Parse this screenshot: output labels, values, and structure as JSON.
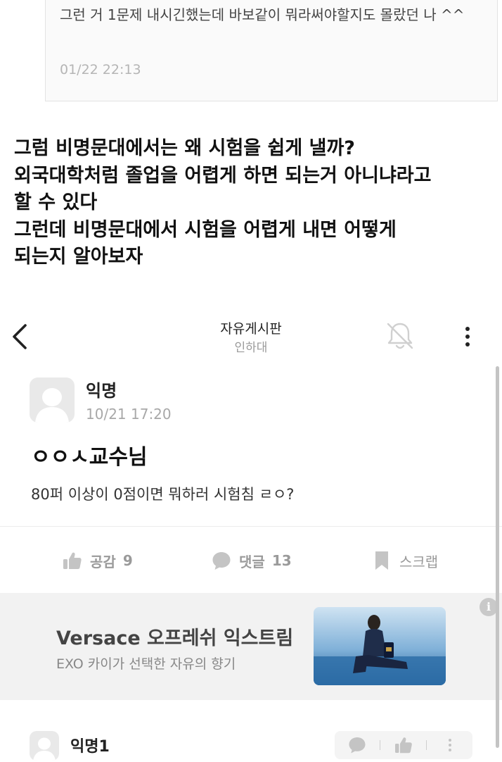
{
  "quote": {
    "text": "그런 거 1문제 내시긴했는데 바보같이 뭐라써야할지도 몰랐던 나 ^^",
    "time": "01/22 22:13"
  },
  "caption": {
    "text": "그럼 비명문대에서는 왜 시험을 쉽게 낼까?\n외국대학처럼 졸업을 어렵게 하면 되는거 아니냐라고\n할 수 있다\n그런데 비명문대에서 시험을 어렵게 내면 어떻게\n되는지 알아보자"
  },
  "header": {
    "title": "자유게시판",
    "subtitle": "인하대",
    "back_icon": "chevron-left-icon",
    "bell_icon": "bell-off-icon",
    "more_icon": "more-vertical-icon"
  },
  "post": {
    "author": "익명",
    "time": "10/21 17:20",
    "title": "ㅇㅇㅅ교수님",
    "body": "80퍼 이상이 0점이면 뭐하러 시험침 ㄹㅇ?"
  },
  "actions": {
    "like_label": "공감",
    "like_count": "9",
    "comment_label": "댓글",
    "comment_count": "13",
    "scrap_label": "스크랩"
  },
  "ad": {
    "info_label": "i",
    "title": "Versace 오프레쉬 익스트림",
    "subtitle": "EXO 카이가 선택한 자유의 향기"
  },
  "comment": {
    "author": "익명1"
  },
  "colors": {
    "muted": "#9a9a9a",
    "ad_background": "#f2f2f2",
    "ad_image_sea": "#2e6fa8"
  }
}
